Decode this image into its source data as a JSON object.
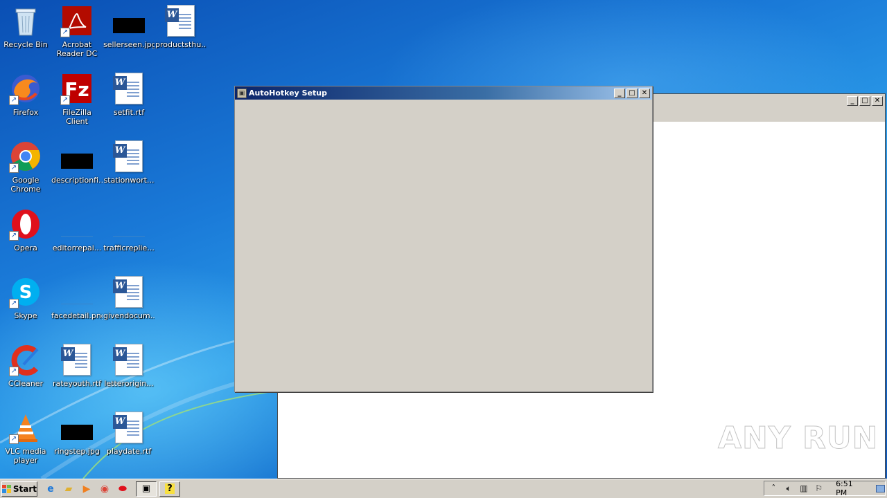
{
  "desktop": {
    "icons": [
      {
        "label": "Recycle Bin",
        "icon": "recycle-bin-icon"
      },
      {
        "label": "Acrobat Reader DC",
        "icon": "acrobat-reader-icon"
      },
      {
        "label": "sellerseen.jpg",
        "icon": "image-file-icon"
      },
      {
        "label": "productsthu...",
        "icon": "word-document-icon"
      },
      {
        "label": "Firefox",
        "icon": "firefox-icon"
      },
      {
        "label": "FileZilla Client",
        "icon": "filezilla-icon"
      },
      {
        "label": "setfit.rtf",
        "icon": "word-document-icon"
      },
      {
        "label": "Google Chrome",
        "icon": "chrome-icon"
      },
      {
        "label": "descriptionfi...",
        "icon": "image-file-icon"
      },
      {
        "label": "stationwort...",
        "icon": "word-document-icon"
      },
      {
        "label": "Opera",
        "icon": "opera-icon"
      },
      {
        "label": "editorrepai...",
        "icon": "image-file-icon"
      },
      {
        "label": "trafficreplie...",
        "icon": "image-file-icon"
      },
      {
        "label": "Skype",
        "icon": "skype-icon"
      },
      {
        "label": "facedetail.png",
        "icon": "image-file-icon"
      },
      {
        "label": "givendocum...",
        "icon": "word-document-icon"
      },
      {
        "label": "CCleaner",
        "icon": "ccleaner-icon"
      },
      {
        "label": "rateyouth.rtf",
        "icon": "word-document-icon"
      },
      {
        "label": "letterorigin...",
        "icon": "word-document-icon"
      },
      {
        "label": "VLC media player",
        "icon": "vlc-icon"
      },
      {
        "label": "ringstep.jpg",
        "icon": "image-file-icon"
      },
      {
        "label": "playdate.rtf",
        "icon": "word-document-icon"
      }
    ]
  },
  "setup_window": {
    "title": "AutoHotkey Setup",
    "minimize": "_",
    "maximize": "□",
    "close": "✕"
  },
  "background_window": {
    "title": "",
    "minimize": "_",
    "maximize": "□",
    "close": "✕"
  },
  "taskbar": {
    "start_label": "Start",
    "clock": "6:51 PM",
    "tray_icons": [
      "chevron-up-icon",
      "speaker-icon",
      "network-icon",
      "flag-icon"
    ]
  },
  "watermark": {
    "text": "ANY RUN"
  },
  "colors": {
    "active_title_start": "#0a246a",
    "active_title_end": "#a6caf0",
    "window_face": "#d4d0c8",
    "desktop_blue": "#1a7ad8"
  }
}
